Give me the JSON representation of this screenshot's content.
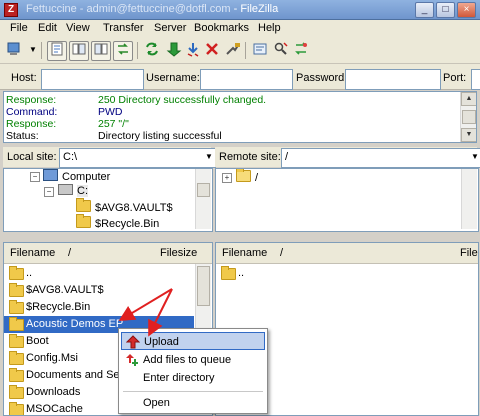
{
  "window": {
    "title_prefix": "Fettuccine - ",
    "title_account": "admin@fettuccine@dotfl.com",
    "title_app": " - FileZilla",
    "controls": [
      "_",
      "□",
      "×"
    ]
  },
  "menu": [
    "File",
    "Edit",
    "View",
    "Transfer",
    "Server",
    "Bookmarks",
    "Help"
  ],
  "quickconnect": {
    "host_label": "Host:",
    "username_label": "Username:",
    "password_label": "Password:",
    "port_label": "Port:",
    "host_value": "",
    "username_value": "",
    "password_value": "",
    "port_value": ""
  },
  "log": [
    {
      "type": "Response:",
      "msg": "250 Directory successfully changed.",
      "color": "#008000"
    },
    {
      "type": "Command:",
      "msg": "PWD",
      "color": "#000080"
    },
    {
      "type": "Response:",
      "msg": "257 \"/\"",
      "color": "#008000"
    },
    {
      "type": "Status:",
      "msg": "Directory listing successful",
      "color": "#000000"
    }
  ],
  "local": {
    "site_label": "Local site:",
    "site_path": "C:\\",
    "tree": [
      "Computer",
      "C:",
      "$AVG8.VAULT$",
      "$Recycle.Bin"
    ],
    "col_filename": "Filename",
    "col_sort": "/",
    "col_filesize": "Filesize",
    "files": [
      "..",
      "$AVG8.VAULT$",
      "$Recycle.Bin",
      "Acoustic Demos EP",
      "Boot",
      "Config.Msi",
      "Documents and Set...",
      "Downloads",
      "MSOCache"
    ],
    "selected_index": 3
  },
  "remote": {
    "site_label": "Remote site:",
    "site_path": "/",
    "tree": [
      "/"
    ],
    "col_filename": "Filename",
    "col_sort": "/",
    "col_filesize": "File",
    "files": [
      ".."
    ]
  },
  "context_menu": {
    "items": [
      {
        "label": "Upload",
        "icon": "upload-arrow-icon"
      },
      {
        "label": "Add files to queue",
        "icon": "add-to-queue-icon"
      },
      {
        "label": "Enter directory",
        "icon": ""
      },
      {
        "label": "Open",
        "icon": ""
      }
    ]
  },
  "colors": {
    "selection": "#316ac5",
    "annotation_arrow": "#e02020",
    "menu_highlight": "#c1d2ee"
  }
}
